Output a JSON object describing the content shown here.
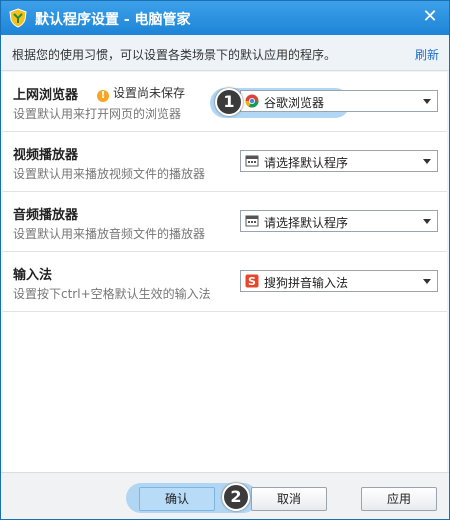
{
  "window": {
    "title": "默认程序设置 - 电脑管家",
    "close_label": "✕"
  },
  "infobar": {
    "text": "根据您的使用习惯，可以设置各类场景下的默认应用的程序。",
    "refresh": "刷新"
  },
  "rows": [
    {
      "title": "上网浏览器",
      "desc": "设置默认用来打开网页的浏览器",
      "warning": "设置尚未保存",
      "selected": "谷歌浏览器",
      "icon": "chrome-icon"
    },
    {
      "title": "视频播放器",
      "desc": "设置默认用来播放视频文件的播放器",
      "selected": "请选择默认程序",
      "icon": "program-icon"
    },
    {
      "title": "音频播放器",
      "desc": "设置默认用来播放音频文件的播放器",
      "selected": "请选择默认程序",
      "icon": "program-icon"
    },
    {
      "title": "输入法",
      "desc": "设置按下ctrl+空格默认生效的输入法",
      "selected": "搜狗拼音输入法",
      "icon": "sogou-icon"
    }
  ],
  "badges": [
    "1",
    "2"
  ],
  "footer": {
    "ok": "确认",
    "cancel": "取消",
    "apply": "应用"
  },
  "colors": {
    "titlebar": "#1d84d6",
    "accent": "#1d6fcc",
    "highlight": "#a8d3f3"
  }
}
